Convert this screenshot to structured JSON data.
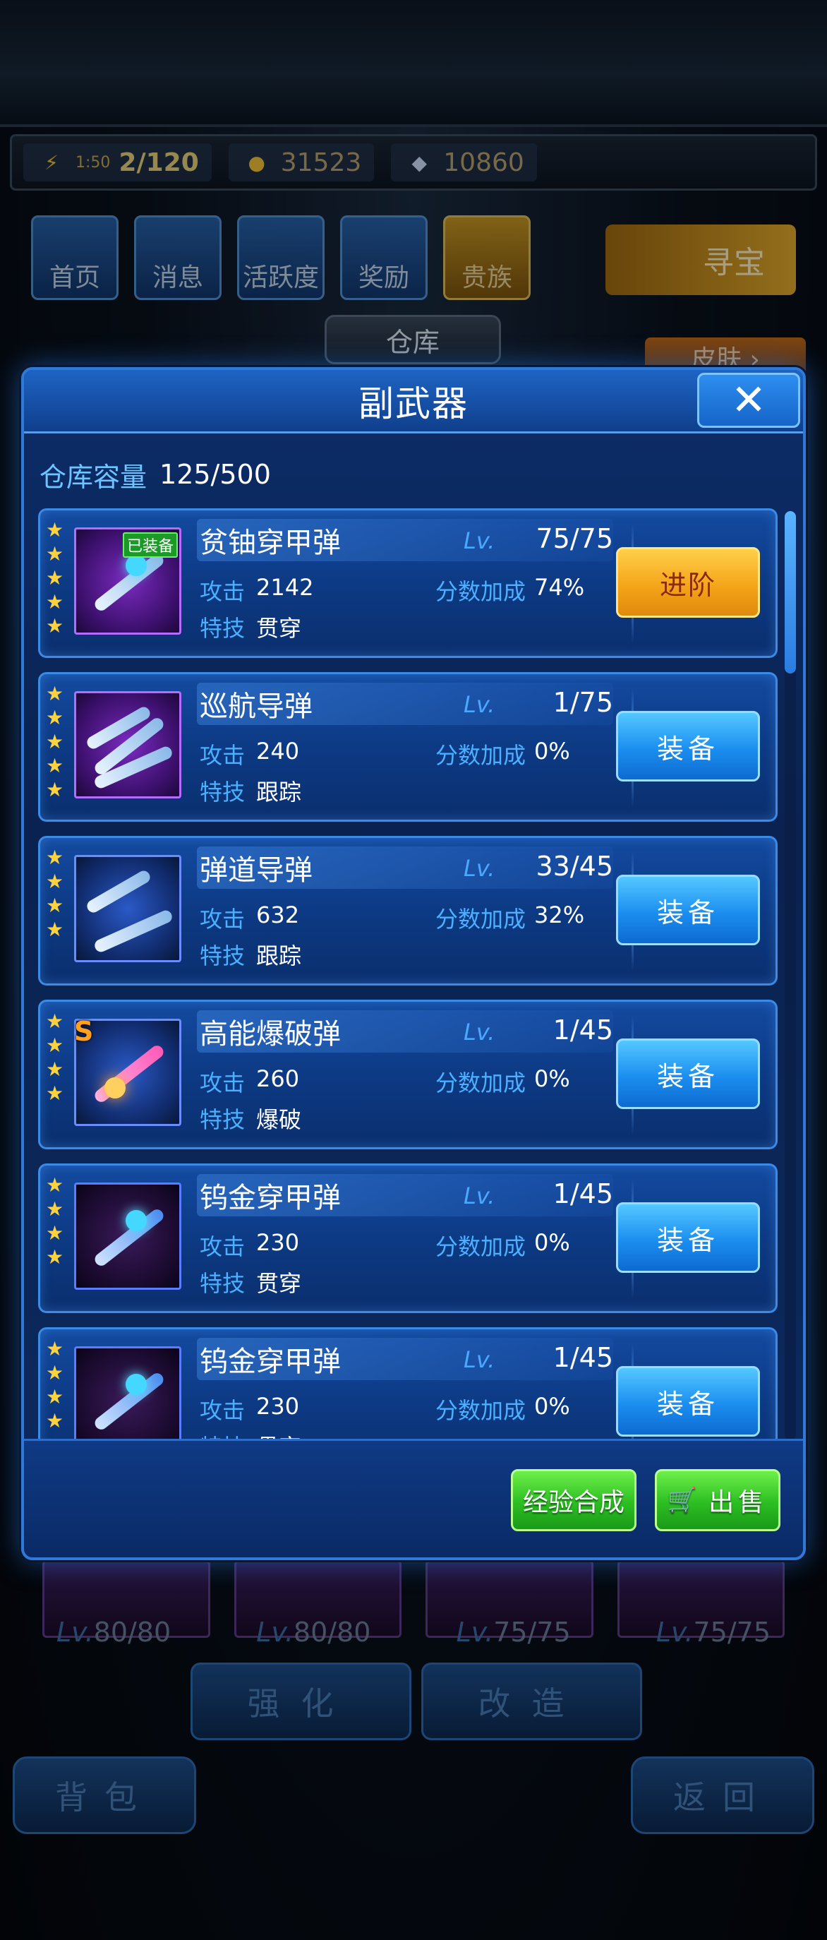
{
  "resources": {
    "energy_timer": "1:50",
    "energy": "2/120",
    "coins": "31523",
    "diamonds": "10860"
  },
  "nav": {
    "home": "首页",
    "messages": "消息",
    "activity": "活跃度",
    "rewards": "奖励",
    "noble": "贵族",
    "treasure": "寻宝"
  },
  "background": {
    "warehouse_tab": "仓库",
    "skin_tab": "皮肤 ›",
    "levels": [
      "80/80",
      "80/80",
      "75/75",
      "75/75"
    ],
    "lv_prefix": "Lv.",
    "enhance": "强化",
    "modify": "改造",
    "backpack": "背包",
    "back": "返回"
  },
  "modal": {
    "title": "副武器",
    "close_glyph": "✕",
    "capacity_label": "仓库容量",
    "capacity_value": "125/500"
  },
  "labels": {
    "lv": "Lv.",
    "attack": "攻击",
    "bonus": "分数加成",
    "skill": "特技",
    "equipped": "已装备",
    "equip": "装备",
    "advance": "进阶",
    "star": "★",
    "s_rank": "S"
  },
  "items": [
    {
      "name": "贫铀穿甲弹",
      "level": "75/75",
      "attack": "2142",
      "bonus": "74%",
      "skill": "贯穿",
      "stars": 5,
      "equipped": true,
      "action": "进阶"
    },
    {
      "name": "巡航导弹",
      "level": "1/75",
      "attack": "240",
      "bonus": "0%",
      "skill": "跟踪",
      "stars": 5,
      "equipped": false,
      "action": "装备"
    },
    {
      "name": "弹道导弹",
      "level": "33/45",
      "attack": "632",
      "bonus": "32%",
      "skill": "跟踪",
      "stars": 4,
      "equipped": false,
      "action": "装备"
    },
    {
      "name": "高能爆破弹",
      "level": "1/45",
      "attack": "260",
      "bonus": "0%",
      "skill": "爆破",
      "stars": 4,
      "equipped": false,
      "action": "装备"
    },
    {
      "name": "钨金穿甲弹",
      "level": "1/45",
      "attack": "230",
      "bonus": "0%",
      "skill": "贯穿",
      "stars": 4,
      "equipped": false,
      "action": "装备"
    },
    {
      "name": "钨金穿甲弹",
      "level": "1/45",
      "attack": "230",
      "bonus": "0%",
      "skill": "贯穿",
      "stars": 4,
      "equipped": false,
      "action": "装备"
    }
  ],
  "footer": {
    "combine": "经验合成",
    "sell": "出售",
    "cart_icon": "🛒"
  }
}
